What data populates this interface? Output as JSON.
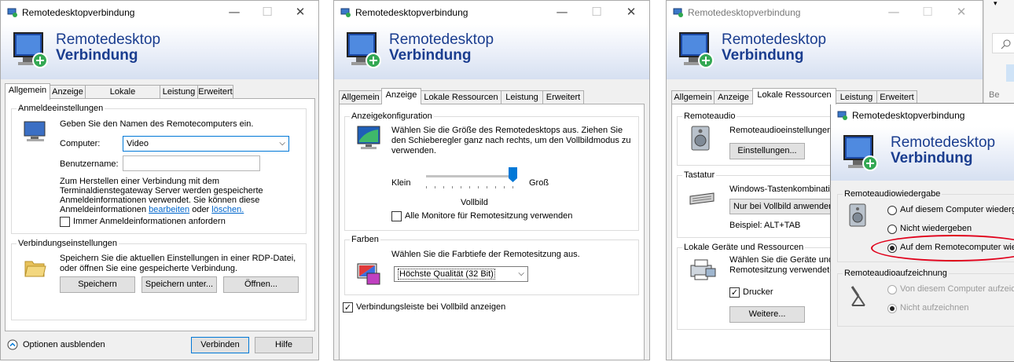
{
  "window_title": "Remotedesktopverbindung",
  "window_controls": {
    "minimize": "—",
    "maximize": "☐",
    "close": "✕"
  },
  "banner": {
    "line1": "Remotedesktop",
    "line2": "Verbindung"
  },
  "tabs": [
    "Allgemein",
    "Anzeige",
    "Lokale Ressourcen",
    "Leistung",
    "Erweitert"
  ],
  "panel1": {
    "logon_group": "Anmeldeeinstellungen",
    "logon_hint": "Geben Sie den Namen des Remotecomputers ein.",
    "computer_label": "Computer:",
    "computer_value": "Video",
    "user_label": "Benutzername:",
    "user_value": "",
    "info_text": "Zum Herstellen einer Verbindung mit dem Terminaldienstegateway Server werden gespeicherte Anmeldeinformationen verwendet. Sie können diese Anmeldeinformationen",
    "link_edit": "bearbeiten",
    "link_or": "oder",
    "link_delete": "löschen.",
    "always_ask": "Immer Anmeldeinformationen anfordern",
    "conn_group": "Verbindungseinstellungen",
    "conn_text": "Speichern Sie die aktuellen Einstellungen in einer RDP-Datei, oder öffnen Sie eine gespeicherte Verbindung.",
    "save": "Speichern",
    "save_as": "Speichern unter...",
    "open": "Öffnen...",
    "hide_options": "Optionen ausblenden",
    "connect": "Verbinden",
    "help": "Hilfe"
  },
  "panel2": {
    "display_group": "Anzeigekonfiguration",
    "display_text": "Wählen Sie die Größe des Remotedesktops aus. Ziehen Sie den Schieberegler ganz nach rechts, um den Vollbildmodus zu verwenden.",
    "small": "Klein",
    "large": "Groß",
    "slider_value": "Vollbild",
    "slider_level": 1.0,
    "all_monitors": "Alle Monitore für Remotesitzung verwenden",
    "colors_group": "Farben",
    "colors_text": "Wählen Sie die Farbtiefe der Remotesitzung aus.",
    "color_value": "Höchste Qualität (32 Bit)",
    "conn_bar": "Verbindungsleiste bei Vollbild anzeigen"
  },
  "panel3": {
    "audio_group": "Remoteaudio",
    "audio_text": "Remoteaudioeinstellungen k",
    "audio_btn": "Einstellungen...",
    "keyboard_group": "Tastatur",
    "keyboard_text": "Windows-Tastenkombinatio",
    "keyboard_value": "Nur bei Vollbild anwenden",
    "keyboard_example": "Beispiel: ALT+TAB",
    "devices_group": "Lokale Geräte und Ressourcen",
    "devices_text": "Wählen Sie die Geräte und Remotesitzung verwendet w",
    "printer": "Drucker",
    "more": "Weitere..."
  },
  "dialog4": {
    "playback_group": "Remoteaudiowiedergabe",
    "opt1": "Auf diesem Computer wiederge",
    "opt2": "Nicht wiedergeben",
    "opt3": "Auf dem Remotecomputer wied",
    "record_group": "Remoteaudioaufzeichnung",
    "rec1": "Von diesem Computer aufzeich",
    "rec2": "Nicht aufzeichnen"
  },
  "bg_partial_text": "Be",
  "colors": {
    "accent": "#0078d7",
    "banner_text": "#1a3d8f",
    "highlight": "#e0001a"
  }
}
